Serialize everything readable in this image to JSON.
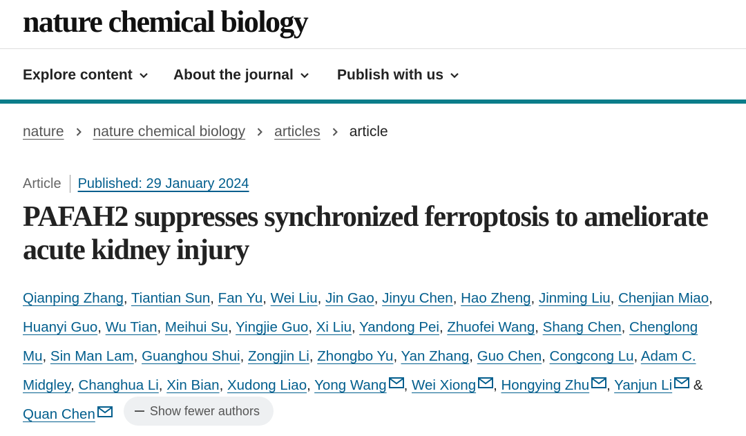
{
  "journal": {
    "name": "nature chemical biology"
  },
  "nav": {
    "items": [
      {
        "label": "Explore content"
      },
      {
        "label": "About the journal"
      },
      {
        "label": "Publish with us"
      }
    ]
  },
  "breadcrumb": {
    "items": [
      "nature",
      "nature chemical biology",
      "articles"
    ],
    "current": "article"
  },
  "article": {
    "type": "Article",
    "published": "Published: 29 January 2024",
    "title": "PAFAH2 suppresses synchronized ferroptosis to ameliorate acute kidney injury"
  },
  "authors": [
    {
      "name": "Qianping Zhang"
    },
    {
      "name": "Tiantian Sun"
    },
    {
      "name": "Fan Yu"
    },
    {
      "name": "Wei Liu"
    },
    {
      "name": "Jin Gao"
    },
    {
      "name": "Jinyu Chen"
    },
    {
      "name": "Hao Zheng"
    },
    {
      "name": "Jinming Liu"
    },
    {
      "name": "Chenjian Miao"
    },
    {
      "name": "Huanyi Guo"
    },
    {
      "name": "Wu Tian"
    },
    {
      "name": "Meihui Su"
    },
    {
      "name": "Yingjie Guo"
    },
    {
      "name": "Xi Liu"
    },
    {
      "name": "Yandong Pei"
    },
    {
      "name": "Zhuofei Wang"
    },
    {
      "name": "Shang Chen"
    },
    {
      "name": "Chenglong Mu"
    },
    {
      "name": "Sin Man Lam"
    },
    {
      "name": "Guanghou Shui"
    },
    {
      "name": "Zongjin Li"
    },
    {
      "name": "Zhongbo Yu"
    },
    {
      "name": "Yan Zhang"
    },
    {
      "name": "Guo Chen"
    },
    {
      "name": "Congcong Lu"
    },
    {
      "name": "Adam C. Midgley"
    },
    {
      "name": "Changhua Li"
    },
    {
      "name": "Xin Bian"
    },
    {
      "name": "Xudong Liao"
    },
    {
      "name": "Yong Wang",
      "corresponding": true
    },
    {
      "name": "Wei Xiong",
      "corresponding": true
    },
    {
      "name": "Hongying Zhu",
      "corresponding": true
    },
    {
      "name": "Yanjun Li",
      "corresponding": true
    },
    {
      "name": "Quan Chen",
      "corresponding": true
    }
  ],
  "authors_final_separator": "&",
  "show_fewer_label": "Show fewer authors",
  "colors": {
    "accent": "#0b7d8a",
    "link": "#025e8d"
  },
  "icons": {
    "nav_chevron": "chevron-down-icon",
    "breadcrumb_separator": "chevron-right-icon",
    "corresponding": "mail-icon",
    "show_fewer": "minus-icon"
  }
}
